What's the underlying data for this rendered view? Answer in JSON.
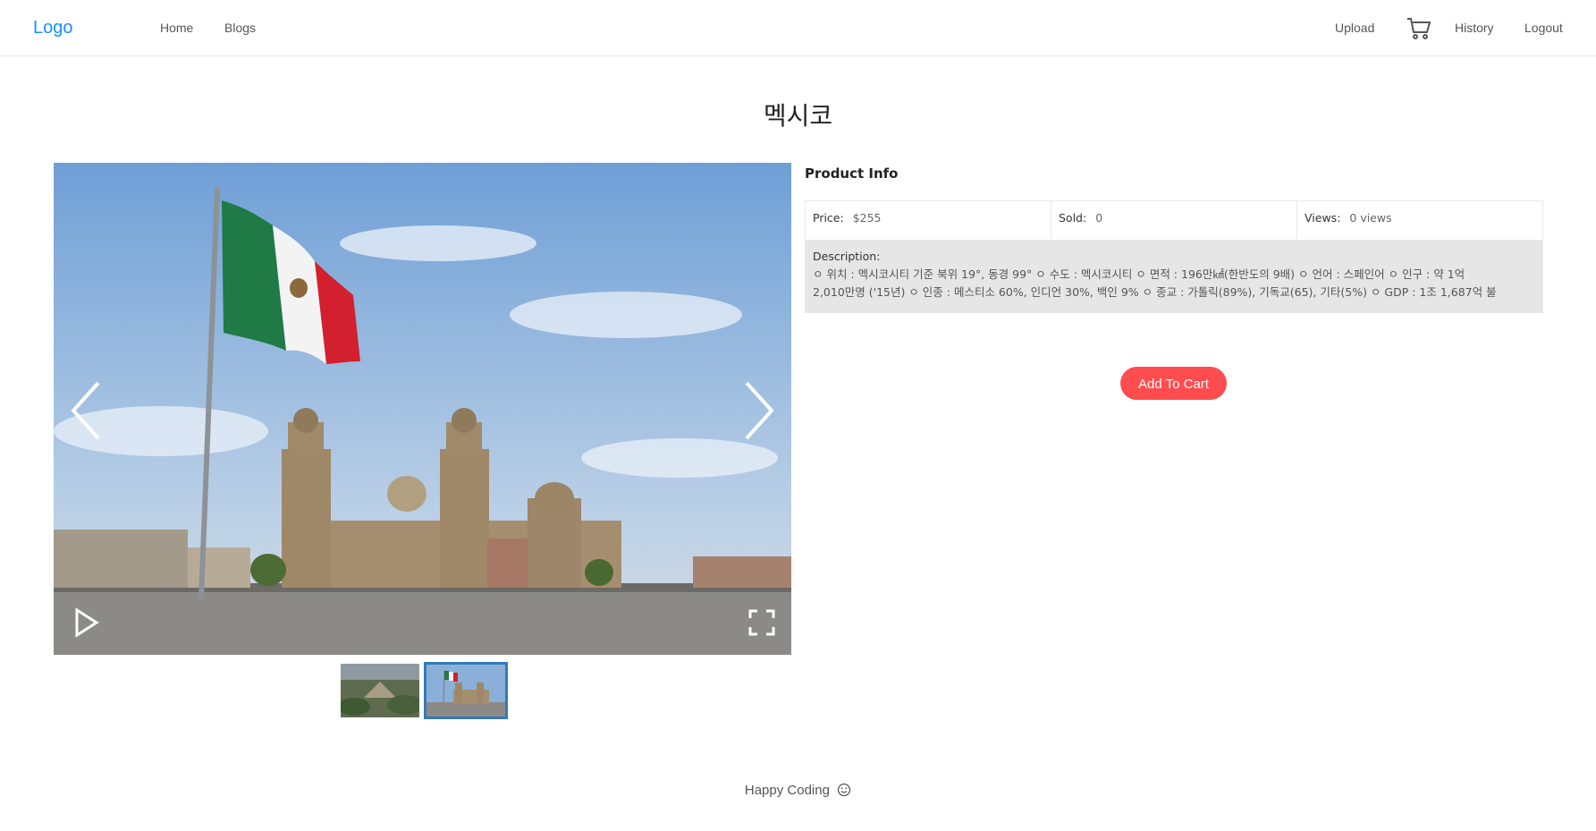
{
  "nav": {
    "logo": "Logo",
    "left_links": [
      "Home",
      "Blogs"
    ],
    "right": {
      "upload": "Upload",
      "cart_icon": "cart-icon",
      "history": "History",
      "logout": "Logout"
    }
  },
  "product": {
    "title": "멕시코",
    "info_heading": "Product Info",
    "price_label": "Price",
    "price_value": "$255",
    "sold_label": "Sold",
    "sold_value": "0",
    "views_label": "Views",
    "views_value": "0 views",
    "description_label": "Description",
    "description_line1": "ㅇ 위치 : 멕시코시티 기준 북위 19°, 동경 99° ㅇ 수도 : 멕시코시티 ㅇ 면적 : 196만㎢(한반도의 9배) ㅇ 언어 : 스페인어 ㅇ 인구 : 약 1억",
    "description_line2": "2,010만명 ('15년) ㅇ 인종 : 메스티소 60%, 인디언 30%, 백인 9% ㅇ 종교 : 가톨릭(89%), 기독교(65), 기타(5%) ㅇ GDP : 1조 1,687억 불",
    "add_to_cart": "Add To Cart"
  },
  "gallery": {
    "icons": [
      "chevron-left-icon",
      "chevron-right-icon",
      "play-icon",
      "fullscreen-icon"
    ],
    "thumbnail_count": 2,
    "active_index": 1
  },
  "footer": {
    "text": "Happy Coding",
    "icon": "smile-icon"
  },
  "colors": {
    "accent": "#1890ff",
    "cart_button": "#ff4d4f",
    "active_thumb_border": "#337ab7"
  }
}
